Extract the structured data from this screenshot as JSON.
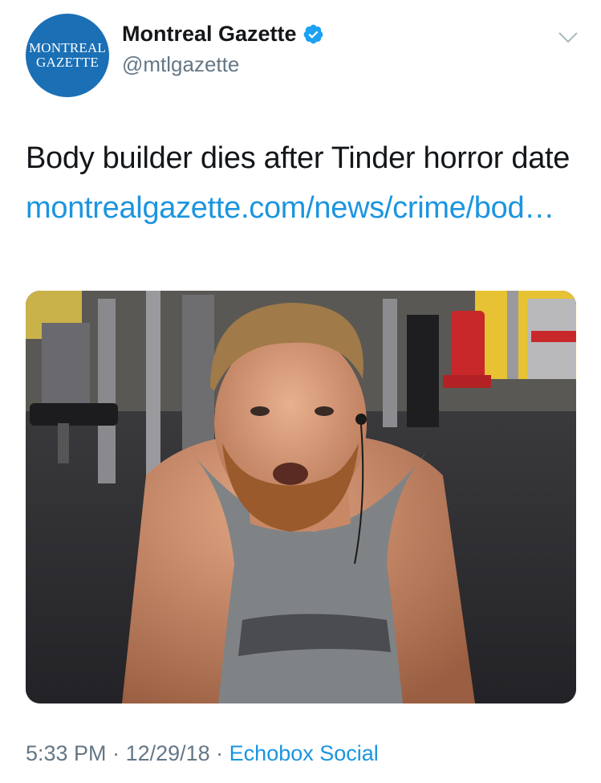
{
  "account": {
    "avatar_line1": "MONTREAL",
    "avatar_line2": "GAZETTE",
    "display_name": "Montreal Gazette",
    "handle": "@mtlgazette",
    "verified": true
  },
  "tweet": {
    "text": "Body builder dies after Tinder horror date ",
    "link_text": "montrealgazette.com/news/crime/bod…",
    "media_alt": "bearded man in grey tank top leaning toward camera in a gym"
  },
  "footer": {
    "time": "5:33 PM",
    "separator": " · ",
    "date": "12/29/18",
    "source": "Echobox Social"
  },
  "colors": {
    "link": "#1b95e0",
    "verified": "#1da1f2",
    "avatar_bg": "#1a6fb5",
    "secondary_text": "#657786"
  },
  "icons": {
    "verified": "verified-badge-icon",
    "caret": "chevron-down-icon"
  }
}
